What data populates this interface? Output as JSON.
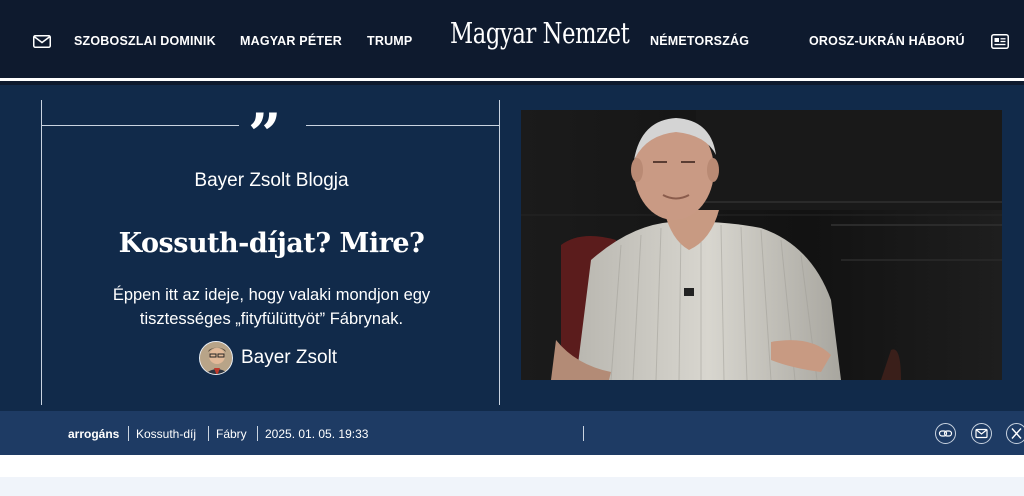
{
  "header": {
    "logo": "Magyar Nemzet",
    "nav": [
      "SZOBOSZLAI DOMINIK",
      "MAGYAR PÉTER",
      "TRUMP",
      "NÉMETORSZÁG",
      "OROSZ-UKRÁN HÁBORÚ"
    ],
    "icons": [
      "mail-icon",
      "newspaper-icon"
    ]
  },
  "article": {
    "blog": "Bayer Zsolt Blogja",
    "title": "Kossuth-díjat? Mire?",
    "lead_line1": "Éppen itt az ideje, hogy valaki mondjon egy",
    "lead_line2": "tisztességes „fityfülüttyöt” Fábrynak.",
    "author": "Bayer Zsolt"
  },
  "meta": {
    "tags": [
      "arrogáns",
      "Kossuth-díj",
      "Fábry"
    ],
    "date": "2025. 01. 05. 19:33",
    "share_icons": [
      "link-icon",
      "email-icon",
      "x-icon"
    ]
  },
  "colors": {
    "topbar": "#0e1a2e",
    "hero": "#112a4a",
    "meta_bar": "#1e3b64"
  }
}
